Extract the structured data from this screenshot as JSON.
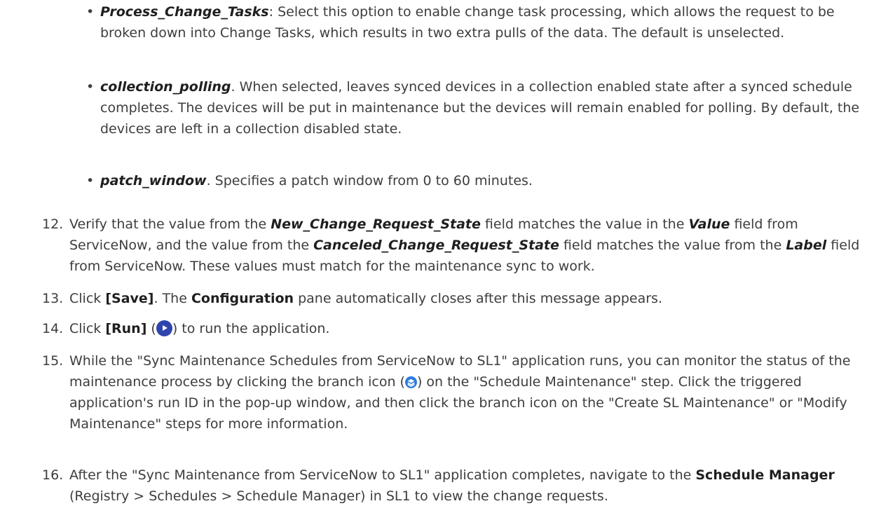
{
  "bullets": [
    {
      "term": "Process_Change_Tasks",
      "separator": ":",
      "text": " Select this option to enable change task processing, which allows the request to be broken down into Change Tasks, which results in two extra pulls of the data. The default is unselected."
    },
    {
      "term": "collection_polling",
      "separator": ".",
      "text": " When selected, leaves synced devices in a collection enabled state after a synced schedule completes. The devices will be put in maintenance but the devices will remain enabled for polling. By default, the devices are left in a collection disabled state."
    },
    {
      "term": "patch_window",
      "separator": ".",
      "text": " Specifies a patch window from 0 to 60 minutes."
    }
  ],
  "steps": {
    "s12": {
      "num": "12.",
      "t1": "Verify that the value from the ",
      "f1": "New_Change_Request_State",
      "t2": " field matches the value in the ",
      "f2": "Value",
      "t3": " field from ServiceNow, and the value from the ",
      "f3": "Canceled_Change_Request_State",
      "t4": " field matches the value from the ",
      "f4": "Label",
      "t5": " field from ServiceNow. These values must match for the maintenance sync to work."
    },
    "s13": {
      "num": "13.",
      "t1": "Click ",
      "save": "[Save]",
      "t2": ". The ",
      "config": "Configuration",
      "t3": " pane automatically closes after this message appears."
    },
    "s14": {
      "num": "14.",
      "t1": "Click ",
      "run": "[Run]",
      "t2": " (",
      "t3": ") to run the application."
    },
    "s15": {
      "num": "15.",
      "t1": "While the \"Sync Maintenance Schedules from ServiceNow to SL1\" application runs, you can monitor the status of the maintenance process by clicking the branch icon (",
      "t2": ") on the \"Schedule Maintenance\" step. Click the triggered application's run ID in the pop-up window, and then click the branch icon on the \"Create SL Maintenance\" or \"Modify Maintenance\" steps for more information."
    },
    "s16": {
      "num": "16.",
      "t1": "After the \"Sync Maintenance from ServiceNow to SL1\" application completes, navigate to the ",
      "sm": "Schedule Manager",
      "t2": " (Registry > Schedules > Schedule Manager) in SL1 to view the change requests."
    }
  },
  "icons": {
    "run": "play-circle-icon",
    "branch": "branch-stack-icon",
    "run_color": "#2f44ad",
    "branch_color": "#2d7be0"
  }
}
